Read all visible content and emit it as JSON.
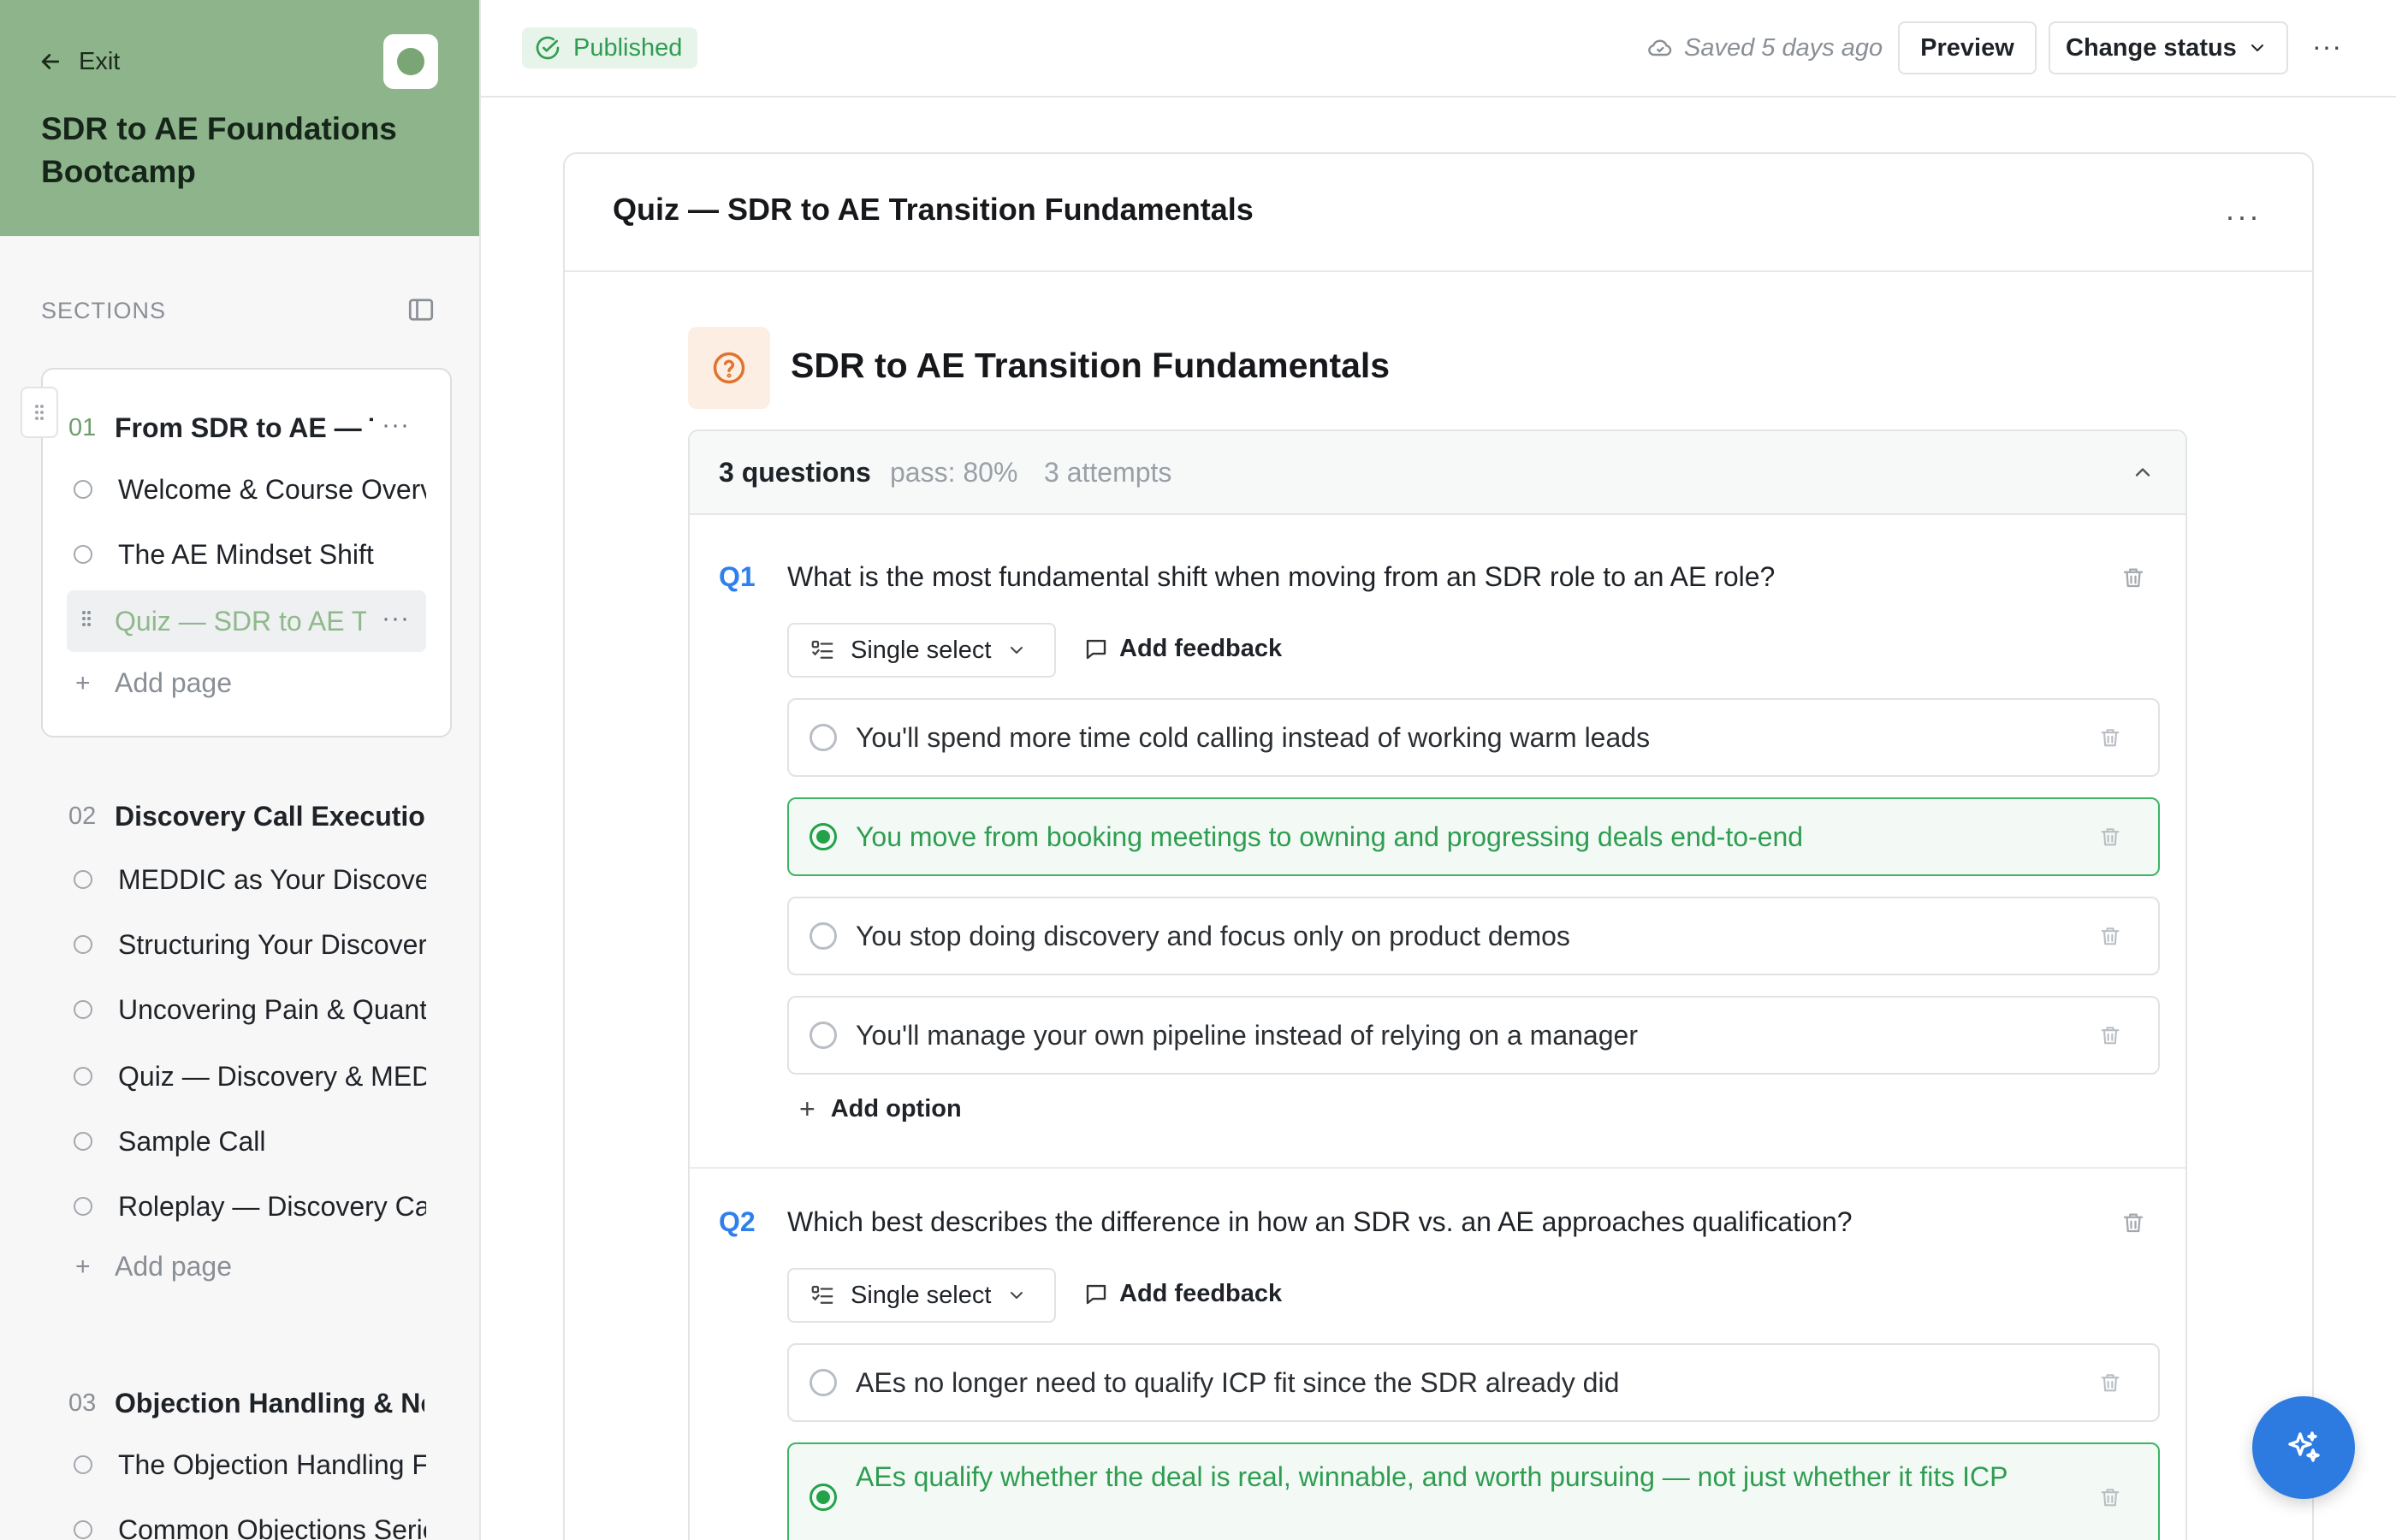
{
  "sidebar": {
    "exit_label": "Exit",
    "course_title": "SDR to AE Foundations Bootcamp",
    "sections_label": "SECTIONS",
    "sections": [
      {
        "number": "01",
        "title": "From SDR to AE — T",
        "pages": [
          "Welcome & Course Overview",
          "The AE Mindset Shift",
          "Quiz — SDR to AE Transition Fundamentals"
        ],
        "add_page": "Add page"
      },
      {
        "number": "02",
        "title": "Discovery Call Execution",
        "pages": [
          "MEDDIC as Your Discovery",
          "Structuring Your Discovery",
          "Uncovering Pain & Quantifying",
          "Quiz — Discovery & MEDDIC",
          "Sample Call",
          "Roleplay — Discovery Call"
        ],
        "add_page": "Add page"
      },
      {
        "number": "03",
        "title": "Objection Handling & Negotiation",
        "pages": [
          "The Objection Handling Framework",
          "Common Objections Series"
        ]
      }
    ]
  },
  "topbar": {
    "status_badge": "Published",
    "saved_text": "Saved 5 days ago",
    "preview_label": "Preview",
    "change_status_label": "Change status",
    "more_label": "···"
  },
  "page": {
    "title": "Quiz — SDR to AE Transition Fundamentals",
    "more_label": "···"
  },
  "quiz": {
    "heading": "SDR to AE Transition Fundamentals",
    "count": "3 questions",
    "pass": "pass: 80%",
    "attempts": "3 attempts",
    "questions": [
      {
        "label": "Q1",
        "text": "What is the most fundamental shift when moving from an SDR role to an AE role?",
        "type": "Single select",
        "feedback_label": "Add feedback",
        "options": [
          {
            "text": "You'll spend more time cold calling instead of working warm leads",
            "correct": false
          },
          {
            "text": "You move from booking meetings to owning and progressing deals end-to-end",
            "correct": true
          },
          {
            "text": "You stop doing discovery and focus only on product demos",
            "correct": false
          },
          {
            "text": "You'll manage your own pipeline instead of relying on a manager",
            "correct": false
          }
        ],
        "add_option_label": "Add option"
      },
      {
        "label": "Q2",
        "text": "Which best describes the difference in how an SDR vs. an AE approaches qualification?",
        "type": "Single select",
        "feedback_label": "Add feedback",
        "options": [
          {
            "text": "AEs no longer need to qualify ICP fit since the SDR already did",
            "correct": false
          },
          {
            "text": "AEs qualify whether the deal is real, winnable, and worth pursuing — not just whether it fits ICP",
            "correct": true
          }
        ]
      }
    ]
  },
  "colors": {
    "sidebar_header": "#8db48a",
    "accent_blue": "#2f80ed",
    "correct_green": "#3cb562",
    "fab_blue": "#2d7be0"
  },
  "icons": {
    "exit": "arrow-left-icon",
    "published": "check-circle-icon",
    "saved": "cloud-icon",
    "quiz": "question-circle-icon",
    "fab": "sparkles-icon"
  }
}
